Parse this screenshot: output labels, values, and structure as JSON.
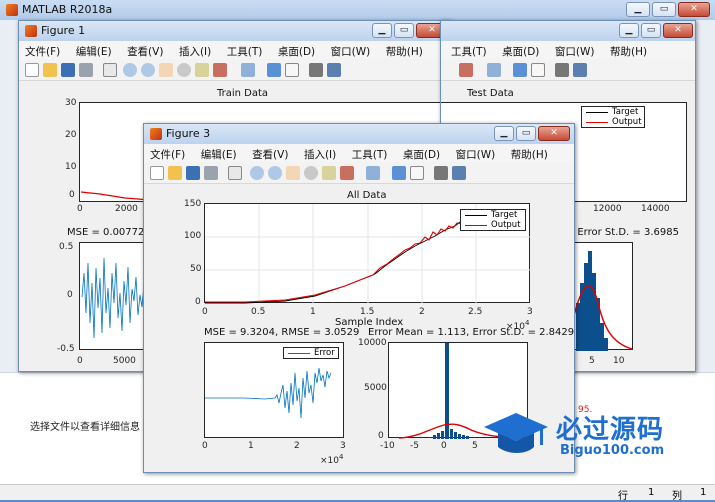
{
  "matlab": {
    "title": "MATLAB R2018a",
    "side_text": "选择文件以查看详细信息",
    "row_label": "行",
    "row_value": "1",
    "col_label": "列",
    "col_value": "1",
    "red_text": "95."
  },
  "menus": [
    "文件(F)",
    "编辑(E)",
    "查看(V)",
    "插入(I)",
    "工具(T)",
    "桌面(D)",
    "窗口(W)",
    "帮助(H)"
  ],
  "figure1": {
    "title": "Figure 1",
    "train_title": "Train Data",
    "test_title": "Test Data",
    "mse_label": "MSE = 0.0077228",
    "err_label": ", Error St.D. = 3.6985",
    "legend": [
      "Target",
      "Output"
    ],
    "train_yticks": [
      "30",
      "20",
      "10",
      "0"
    ],
    "train_xticks": [
      "0",
      "2000"
    ],
    "test_xticks": [
      "12000",
      "14000"
    ],
    "mse_yticks": [
      "0.5",
      "0",
      "-0.5"
    ],
    "mse_xticks": [
      "0",
      "5000"
    ],
    "hist_xticks": [
      "5",
      "10"
    ]
  },
  "figure3": {
    "title": "Figure 3",
    "all_title": "All Data",
    "xlabel": "Sample Index",
    "exp_label": "×10",
    "exp_power": "4",
    "legend": [
      "Target",
      "Output"
    ],
    "yticks": [
      "150",
      "100",
      "50",
      "0"
    ],
    "xticks": [
      "0",
      "0.5",
      "1",
      "1.5",
      "2",
      "2.5",
      "3"
    ],
    "mse_title": "MSE = 9.3204, RMSE = 3.0529",
    "err_title": "Error Mean = 1.113, Error St.D. = 2.8429",
    "error_legend": "Error",
    "err_xticks": [
      "0",
      "1",
      "2",
      "3"
    ],
    "hist_yticks": [
      "10000",
      "5000",
      "0"
    ],
    "hist_xticks": [
      "-10",
      "-5",
      "0",
      "5"
    ]
  },
  "watermark": {
    "cn": "必过源码",
    "url": "Biguo100.com"
  },
  "colors": {
    "target": "#000000",
    "output": "#e00000",
    "error_line": "#0072bd",
    "hist_bar": "#0b4f8c",
    "desktop_bg": "#5b8cc7"
  }
}
